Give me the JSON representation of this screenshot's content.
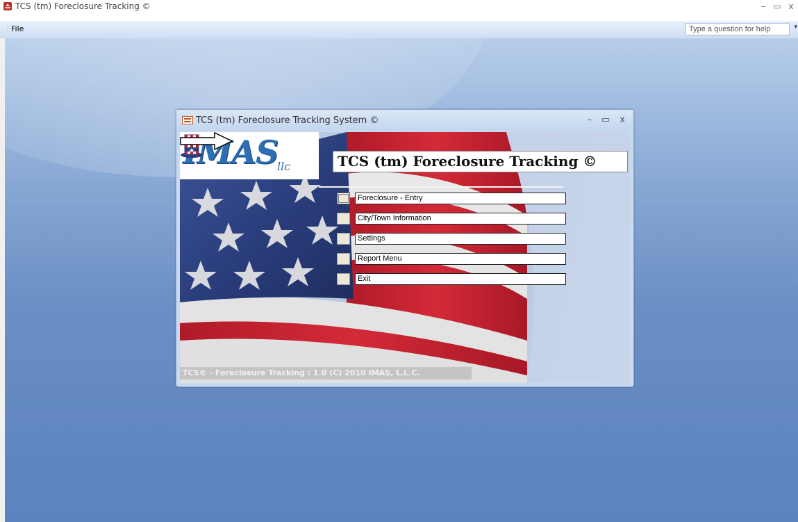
{
  "app": {
    "title": "TCS (tm) Foreclosure Tracking ©",
    "controls": {
      "minimize": "–",
      "restore": "▭",
      "close": "x"
    }
  },
  "menubar": {
    "file_label": "File",
    "help_placeholder": "Type a question for help"
  },
  "form": {
    "title": "TCS (tm) Foreclosure Tracking System ©",
    "controls": {
      "minimize": "–",
      "restore": "▭",
      "close": "x"
    },
    "logo": {
      "text": "IMAS",
      "suffix": "llc"
    },
    "heading": "TCS (tm) Foreclosure Tracking ©",
    "menu_items": [
      {
        "label": "Foreclosure - Entry"
      },
      {
        "label": "City/Town Information"
      },
      {
        "label": "Settings"
      },
      {
        "label": "Report Menu"
      },
      {
        "label": "Exit"
      }
    ],
    "footer": "TCS© - Foreclosure Tracking : 1.0  (C) 2010 IMAS, L.L.C."
  },
  "colors": {
    "workspace_top": "#b6cde9",
    "workspace_bottom": "#5c83c0",
    "flag_red": "#c8202e",
    "flag_blue": "#2b3f7e",
    "logo_blue": "#2d6fb4"
  }
}
